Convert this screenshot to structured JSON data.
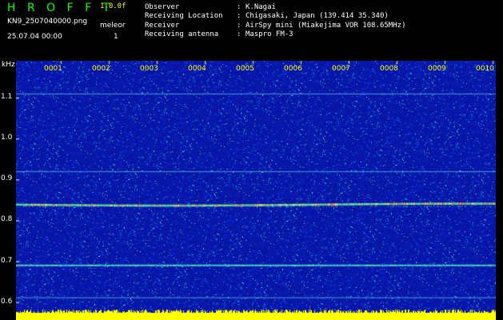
{
  "header": {
    "brand": "H R O F F T",
    "version": "1.0.0f",
    "filename": "KN9_2507040000.png",
    "meleor_label": "meleor",
    "datetime": "25.07.04 00:00",
    "count": "1",
    "info": [
      {
        "label": "Observer",
        "sep": ":",
        "value": "K.Nagai"
      },
      {
        "label": "Receiving Location",
        "sep": ":",
        "value": "Chigasaki, Japan (139.414 35.340)"
      },
      {
        "label": "Receiver",
        "sep": ":",
        "value": "AirSpy mini (Miakejima VOR 108.65MHz)"
      },
      {
        "label": "Receiving antenna",
        "sep": ":",
        "value": "Maspro FM-3"
      }
    ],
    "colors": {
      "brand": "#00ff00",
      "version": "#ffff00",
      "filename": "#ffffff",
      "meleor": "#ffffff",
      "datetime": "#ffffff",
      "count": "#ffffff"
    }
  },
  "plot": {
    "y_unit": "kHz",
    "y_ticks": [
      "1.1",
      "1.0",
      "0.9",
      "0.8",
      "0.7",
      "0.6"
    ],
    "y_range": [
      0.58,
      1.19
    ],
    "x_ticks": [
      "0001",
      "0002",
      "0003",
      "0004",
      "0005",
      "0006",
      "0007",
      "0008",
      "0009",
      "0010"
    ],
    "background_color": "#0a1a9a",
    "signal_lines_khz": [
      {
        "freq_khz": 1.11,
        "strength": "faint"
      },
      {
        "freq_khz": 0.92,
        "strength": "faint"
      },
      {
        "freq_khz": 0.838,
        "strength": "strong"
      },
      {
        "freq_khz": 0.69,
        "strength": "medium"
      },
      {
        "freq_khz": 0.612,
        "strength": "faint"
      }
    ],
    "baseline_color": "#ffff00"
  }
}
